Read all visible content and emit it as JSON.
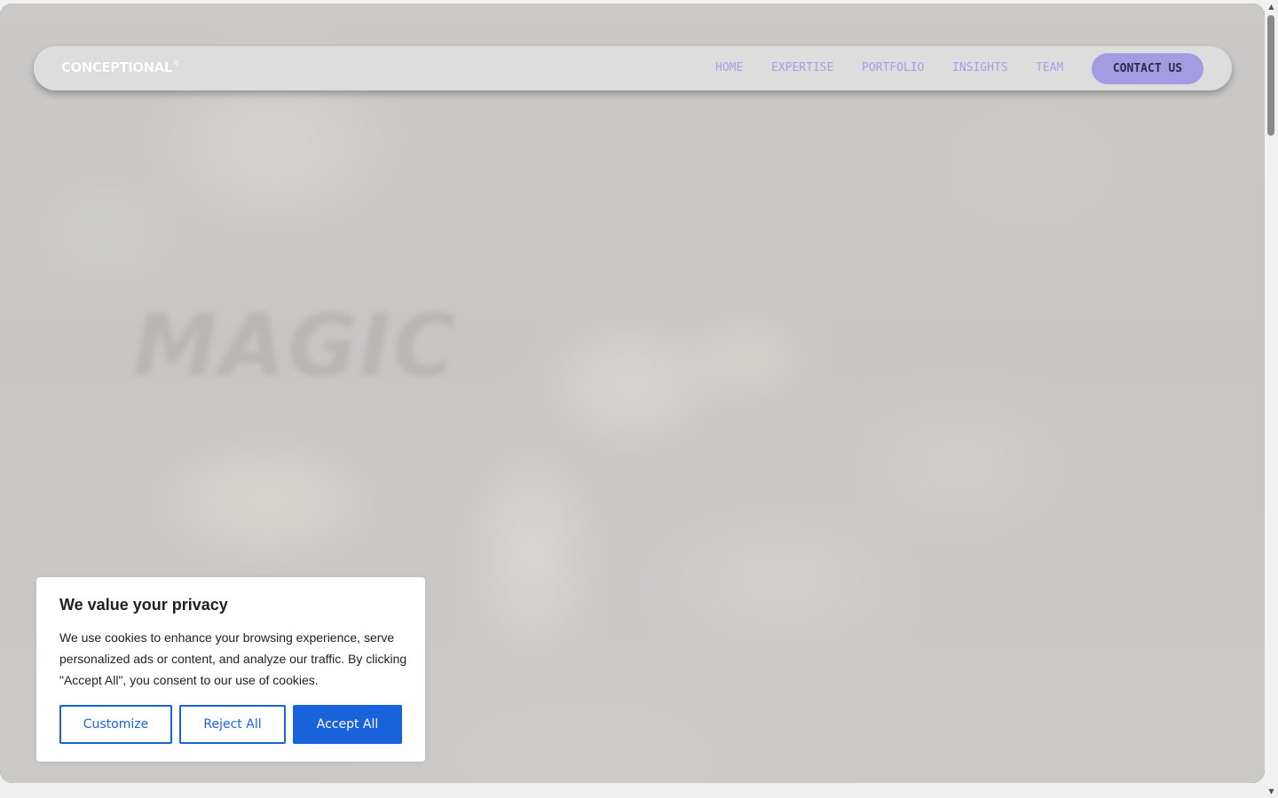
{
  "brand": {
    "logo_text": "CONCEPTIONAL",
    "logo_mark": "®"
  },
  "hero": {
    "background_word": "MAGIC"
  },
  "nav": {
    "items": [
      {
        "label": "HOME"
      },
      {
        "label": "EXPERTISE"
      },
      {
        "label": "PORTFOLIO"
      },
      {
        "label": "INSIGHTS"
      },
      {
        "label": "TEAM"
      }
    ],
    "cta_label": "CONTACT US"
  },
  "cookie_banner": {
    "title": "We value your privacy",
    "body": "We use cookies to enhance your browsing experience, serve personalized ads or content, and analyze our traffic. By clicking \"Accept All\", you consent to our use of cookies.",
    "buttons": {
      "customize": "Customize",
      "reject": "Reject All",
      "accept": "Accept All"
    }
  },
  "scrollbar": {
    "up_glyph": "▲",
    "down_glyph": "▼"
  },
  "colors": {
    "accent": "#a39ce2",
    "nav_text": "#a79ee6",
    "consent_blue": "#1863dc"
  }
}
